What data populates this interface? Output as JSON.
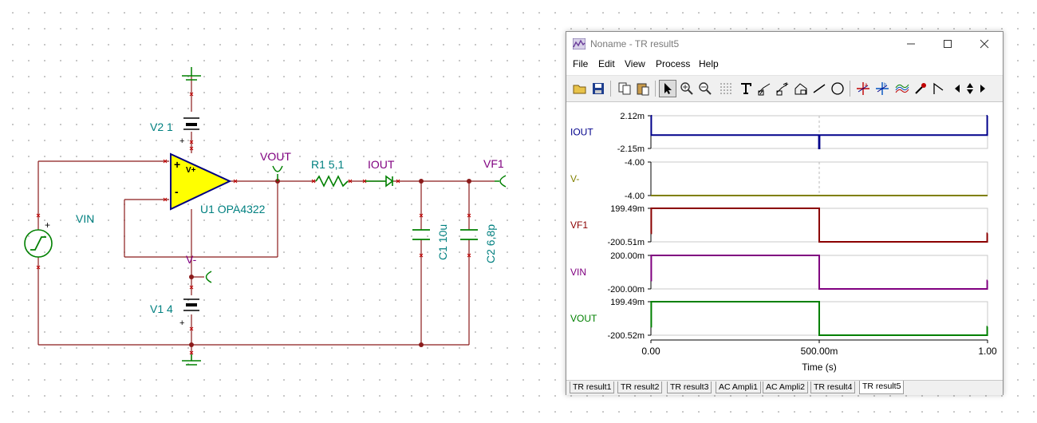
{
  "schematic": {
    "labels": {
      "v2": "V2 1",
      "v1": "V1 4",
      "vin": "VIN",
      "vout": "VOUT",
      "r1": "R1 5,1",
      "iout": "IOUT",
      "vf1": "VF1",
      "u1": "U1 OPA4322",
      "vminus": "V-",
      "c1": "C1 10u",
      "c2": "C2 6,8p",
      "opamp_vplus": "V+",
      "plus": "+",
      "minus": "-"
    }
  },
  "window": {
    "title": "Noname - TR result5",
    "menu": [
      "File",
      "Edit",
      "View",
      "Process",
      "Help"
    ],
    "toolbar_icons": [
      "open-folder-icon",
      "save-icon",
      "copy-icon",
      "paste-icon",
      "pointer-icon",
      "zoom-in-icon",
      "zoom-out-icon",
      "grid-icon",
      "text-icon",
      "curve-label-a-icon",
      "curve-label-b-icon",
      "curve-label-c-icon",
      "line-icon",
      "circle-icon",
      "cursor-a-icon",
      "cursor-b-icon",
      "cursor-curves-icon",
      "pipette-icon",
      "step-icon",
      "arrow-left-icon",
      "arrow-updown-icon",
      "arrow-right-icon"
    ],
    "tabs": [
      "TR result1",
      "TR result2",
      "TR result3",
      "AC Ampli1",
      "AC Ampli2",
      "TR result4",
      "TR result5"
    ],
    "active_tab": "TR result5"
  },
  "chart_data": {
    "type": "line",
    "xlabel": "Time (s)",
    "xlim": [
      0,
      1
    ],
    "x_ticks": [
      "0.00",
      "500.00m",
      "1.00"
    ],
    "series": [
      {
        "name": "IOUT",
        "color": "#00008b",
        "y_top": "2.12m",
        "y_bottom": "-2.15m",
        "ylim": [
          -0.00215,
          0.00212
        ],
        "x": [
          0,
          0.001,
          0.001,
          0.499,
          0.499,
          0.501,
          0.501,
          0.999,
          0.999,
          1.0
        ],
        "values": [
          0.00212,
          0.00212,
          -0.0004,
          -0.0004,
          -0.00215,
          -0.00215,
          -0.0004,
          -0.0004,
          0.00212,
          0.00212
        ]
      },
      {
        "name": "V-",
        "color": "#808000",
        "y_top": "-4.00",
        "y_bottom": "-4.00",
        "ylim": [
          -4.0,
          -4.0
        ],
        "x": [
          0,
          1.0
        ],
        "values": [
          -4.0,
          -4.0
        ]
      },
      {
        "name": "VF1",
        "color": "#8b0000",
        "y_top": "199.49m",
        "y_bottom": "-200.51m",
        "ylim": [
          -0.20051,
          0.19949
        ],
        "x": [
          0,
          0.001,
          0.001,
          0.5,
          0.5,
          0.999,
          0.999,
          1.0
        ],
        "values": [
          -0.1,
          -0.1,
          0.19949,
          0.19949,
          -0.20051,
          -0.20051,
          -0.1,
          -0.1
        ]
      },
      {
        "name": "VIN",
        "color": "#800080",
        "y_top": "200.00m",
        "y_bottom": "-200.00m",
        "ylim": [
          -0.2,
          0.2
        ],
        "x": [
          0,
          0.001,
          0.001,
          0.5,
          0.5,
          0.999,
          0.999,
          1.0
        ],
        "values": [
          -0.1,
          -0.1,
          0.2,
          0.2,
          -0.2,
          -0.2,
          -0.1,
          -0.1
        ]
      },
      {
        "name": "VOUT",
        "color": "#008000",
        "y_top": "199.49m",
        "y_bottom": "-200.52m",
        "ylim": [
          -0.20052,
          0.19949
        ],
        "x": [
          0,
          0.001,
          0.001,
          0.5,
          0.5,
          0.999,
          0.999,
          1.0
        ],
        "values": [
          -0.1,
          -0.1,
          0.19949,
          0.19949,
          -0.20052,
          -0.20052,
          -0.1,
          -0.1
        ]
      }
    ],
    "cursor_x": 0.5
  }
}
